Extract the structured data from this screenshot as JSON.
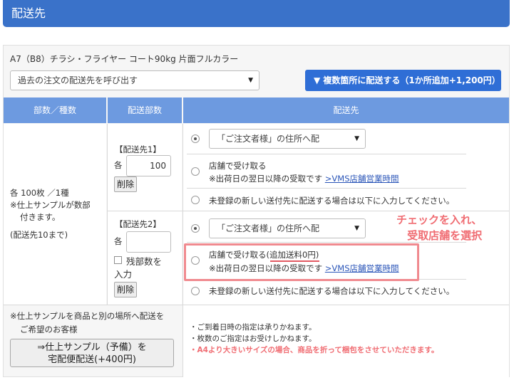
{
  "header": {
    "title": "配送先"
  },
  "product": {
    "name": "A7（B8）チラシ・フライヤー コート90kg 片面フルカラー"
  },
  "history_select": {
    "value": "過去の注文の配送先を呼び出す"
  },
  "multi_button": {
    "label": "▼ 複数箇所に配送する（1か所追加+1,200円）"
  },
  "table_headers": [
    "部数／種数",
    "配送部数",
    "配送先"
  ],
  "left_info": {
    "line1": "各 100枚 ／1種",
    "line2": "※仕上サンプルが数部",
    "line3": "付きます。",
    "line4": "(配送先10まで)"
  },
  "dest1": {
    "label": "【配送先1】",
    "prefix": "各",
    "qty": "100",
    "delete_label": "削除",
    "address_select": "「ご注文者様」の住所へ配",
    "store_line1": "店舗で受け取る",
    "store_line2": "※出荷日の翌日以降の受取です",
    "store_link": ">VMS店舗営業時間",
    "new_address": "未登録の新しい送付先に配送する場合は以下に入力してください。"
  },
  "dest2": {
    "label": "【配送先2】",
    "prefix": "各",
    "qty": "",
    "checkbox_label_1": "残部数を",
    "checkbox_label_2": "入力",
    "delete_label": "削除",
    "address_select": "「ご注文者様」の住所へ配",
    "store_line1_a": "店舗で受け取る(",
    "store_line1_b": "追加送料0円",
    "store_line1_c": ")",
    "store_line2": "※出荷日の翌日以降の受取です",
    "store_link": ">VMS店舗営業時間",
    "new_address": "未登録の新しい送付先に配送する場合は以下に入力してください。"
  },
  "annotation": {
    "line1": "チェックを入れ、",
    "line2": "受取店舗を選択"
  },
  "sample": {
    "note1": "※仕上サンプルを商品と別の場所へ配送を",
    "note2": "ご希望のお客様",
    "button_line1": "⇒仕上サンプル（予備）を",
    "button_line2": "宅配便配送(+400円)"
  },
  "notes": {
    "n1": "・ご到着日時の指定は承りかねます。",
    "n2": "・枚数のご指定はお受けしかねます。",
    "n3": "・A4より大きいサイズの場合、商品を折って梱包をさせていただきます。"
  },
  "colors": {
    "header": "#3a72c9",
    "button": "#2f6ed6",
    "table_header": "#6d9ae0",
    "annotation": "#f06d73"
  }
}
